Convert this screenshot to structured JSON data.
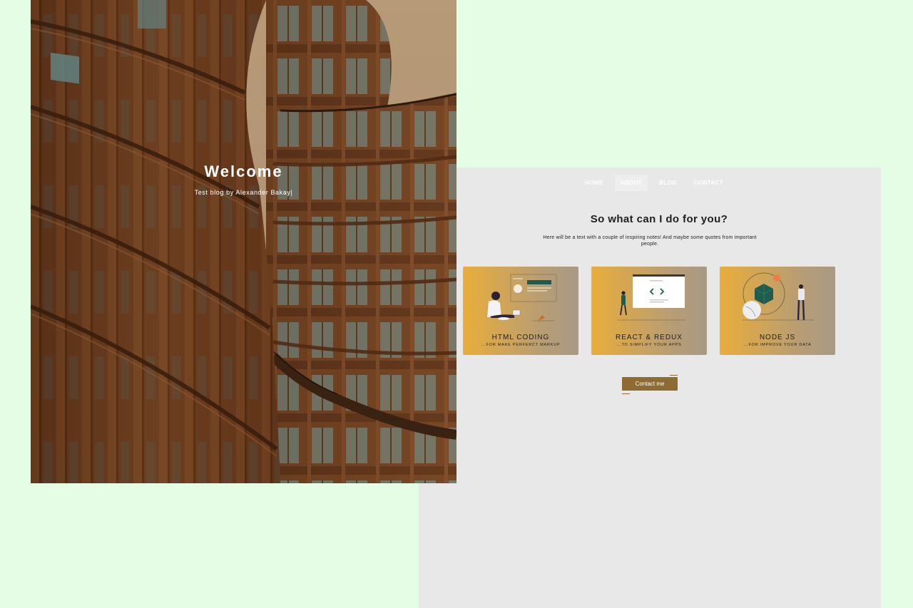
{
  "hero": {
    "title": "Welcome",
    "subtitle": "Test blog by Alexander Bakay|"
  },
  "nav": {
    "items": [
      {
        "label": "HOME",
        "active": false
      },
      {
        "label": "ABOUT",
        "active": true
      },
      {
        "label": "BLOG",
        "active": false
      },
      {
        "label": "CONTACT",
        "active": false
      }
    ]
  },
  "about": {
    "title": "So what can I do for you?",
    "text": "Here will be a text with a couple of inspiring notes! And maybe some quotes from important people."
  },
  "cards": [
    {
      "title": "HTML CODING",
      "subtitle": "...FOR MAKE PERFERCT MARKUP",
      "icon": "person-laptop-illustration"
    },
    {
      "title": "REACT & REDUX",
      "subtitle": "...TO SIMPLIFY YOUR APPS",
      "icon": "code-window-illustration"
    },
    {
      "title": "NODE JS",
      "subtitle": "...FOR IMPROVE YOUR DATA",
      "icon": "data-cube-illustration"
    }
  ],
  "contact": {
    "label": "Contact me"
  },
  "colors": {
    "page_bg": "#e4fde4",
    "panel_bg": "#e8e8e8",
    "accent_brown": "#8f6b34",
    "card_gold": "#e9ad3b",
    "illus_green": "#1f5c4d"
  }
}
